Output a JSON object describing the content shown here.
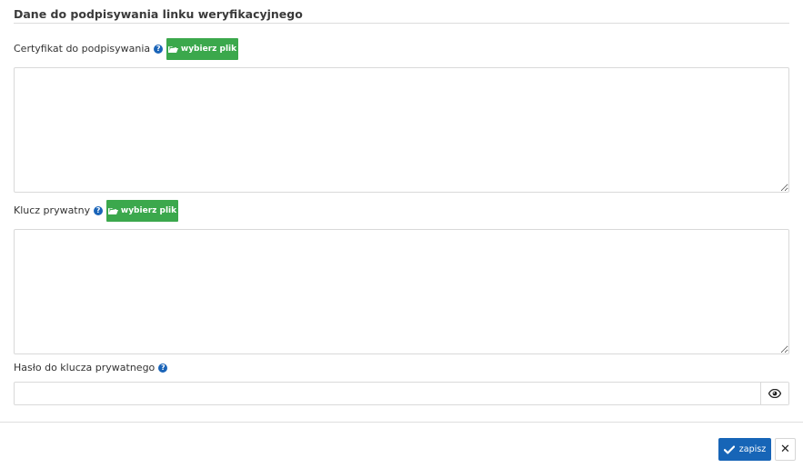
{
  "section": {
    "title": "Dane do podpisywania linku weryfikacyjnego"
  },
  "certificate": {
    "label": "Certyfikat do podpisywania",
    "help_icon": "question-circle-icon",
    "file_button_label": "wybierz plik",
    "file_button_icon": "folder-open-icon",
    "value": ""
  },
  "private_key": {
    "label": "Klucz prywatny",
    "help_icon": "question-circle-icon",
    "file_button_label": "wybierz plik",
    "file_button_icon": "folder-open-icon",
    "value": ""
  },
  "private_key_password": {
    "label": "Hasło do klucza prywatnego",
    "help_icon": "question-circle-icon",
    "value": "",
    "toggle_icon": "eye-icon"
  },
  "footer": {
    "save_label": "zapisz",
    "save_icon": "check-icon",
    "close_glyph": "✕",
    "close_icon": "close-icon"
  },
  "colors": {
    "primary": "#1765b7",
    "success": "#3ba84c",
    "help": "#1a64b8"
  }
}
